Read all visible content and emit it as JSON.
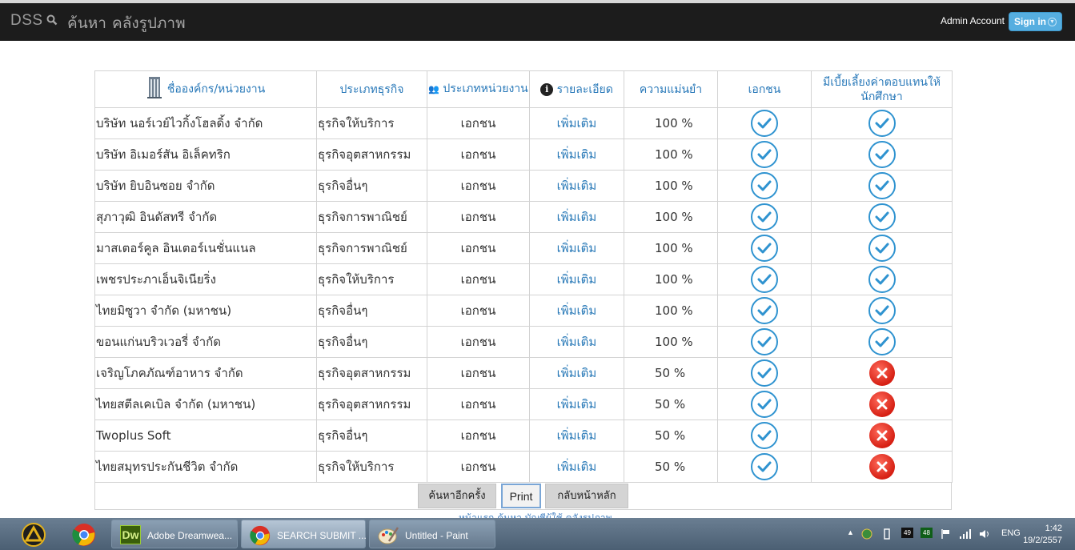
{
  "navbar": {
    "brand": "DSS",
    "search_link": "ค้นหา",
    "gallery_link": "คลังรูปภาพ",
    "account": "Admin Account",
    "signin": "Sign in"
  },
  "table": {
    "headers": {
      "org": "ชื่อองค์กร/หน่วยงาน",
      "biz": "ประเภทธุรกิจ",
      "unit": "ประเภทหน่วยงาน",
      "detail": "รายละเอียด",
      "accuracy": "ความแม่นยำ",
      "private": "เอกชน",
      "allowance": "มีเบี้ยเลี้ยงค่าตอบแทนให้นักศึกษา"
    },
    "rows": [
      {
        "org": "บริษัท นอร์เวย์ไวกิ้งโฮลดิ้ง จำกัด",
        "biz": "ธุรกิจให้บริการ",
        "unit": "เอกชน",
        "detail": "เพิ่มเติม",
        "accuracy": "100 %",
        "private": true,
        "allowance": true
      },
      {
        "org": "บริษัท อิเมอร์สัน อิเล็คทริก",
        "biz": "ธุรกิจอุตสาหกรรม",
        "unit": "เอกชน",
        "detail": "เพิ่มเติม",
        "accuracy": "100 %",
        "private": true,
        "allowance": true
      },
      {
        "org": "บริษัท ยิบอินซอย จำกัด",
        "biz": "ธุรกิจอื่นๆ",
        "unit": "เอกชน",
        "detail": "เพิ่มเติม",
        "accuracy": "100 %",
        "private": true,
        "allowance": true
      },
      {
        "org": "สุภาวุฒิ อินดัสทรี จำกัด",
        "biz": "ธุรกิจการพาณิชย์",
        "unit": "เอกชน",
        "detail": "เพิ่มเติม",
        "accuracy": "100 %",
        "private": true,
        "allowance": true
      },
      {
        "org": "มาสเตอร์คูล อินเตอร์เนชั่นแนล",
        "biz": "ธุรกิจการพาณิชย์",
        "unit": "เอกชน",
        "detail": "เพิ่มเติม",
        "accuracy": "100 %",
        "private": true,
        "allowance": true
      },
      {
        "org": "เพชรประภาเอ็นจิเนียริ่ง",
        "biz": "ธุรกิจให้บริการ",
        "unit": "เอกชน",
        "detail": "เพิ่มเติม",
        "accuracy": "100 %",
        "private": true,
        "allowance": true
      },
      {
        "org": "ไทยมิซูวา จำกัด (มหาชน)",
        "biz": "ธุรกิจอื่นๆ",
        "unit": "เอกชน",
        "detail": "เพิ่มเติม",
        "accuracy": "100 %",
        "private": true,
        "allowance": true
      },
      {
        "org": "ขอนแก่นบริวเวอรี่ จำกัด",
        "biz": "ธุรกิจอื่นๆ",
        "unit": "เอกชน",
        "detail": "เพิ่มเติม",
        "accuracy": "100 %",
        "private": true,
        "allowance": true
      },
      {
        "org": "เจริญโภคภัณฑ์อาหาร จำกัด",
        "biz": "ธุรกิจอุตสาหกรรม",
        "unit": "เอกชน",
        "detail": "เพิ่มเติม",
        "accuracy": "50 %",
        "private": true,
        "allowance": false
      },
      {
        "org": "ไทยสตีลเคเบิล จำกัด (มหาชน)",
        "biz": "ธุรกิจอุตสาหกรรม",
        "unit": "เอกชน",
        "detail": "เพิ่มเติม",
        "accuracy": "50 %",
        "private": true,
        "allowance": false
      },
      {
        "org": "Twoplus Soft",
        "biz": "ธุรกิจอื่นๆ",
        "unit": "เอกชน",
        "detail": "เพิ่มเติม",
        "accuracy": "50 %",
        "private": true,
        "allowance": false
      },
      {
        "org": "ไทยสมุทรประกันชีวิต จำกัด",
        "biz": "ธุรกิจให้บริการ",
        "unit": "เอกชน",
        "detail": "เพิ่มเติม",
        "accuracy": "50 %",
        "private": true,
        "allowance": false
      }
    ]
  },
  "actions": {
    "search_again": "ค้นหาอีกครั้ง",
    "print": "Print",
    "home": "กลับหน้าหลัก"
  },
  "footer_links": "หน้าแรก ค้นหา บัญชีผู้ใช้ คลังรูปภาพ",
  "taskbar": {
    "items": [
      "Adobe Dreamwea...",
      "SEARCH SUBMIT ...",
      "Untitled - Paint"
    ],
    "tray_num1": "49",
    "tray_num2": "48",
    "lang": "ENG",
    "time": "1:42",
    "date": "19/2/2557"
  },
  "colors": {
    "navbar": "#1c1c1c",
    "header_text": "#2979b9",
    "check": "#2f93d0",
    "cross": "#d62014",
    "signin": "#56aee0"
  }
}
